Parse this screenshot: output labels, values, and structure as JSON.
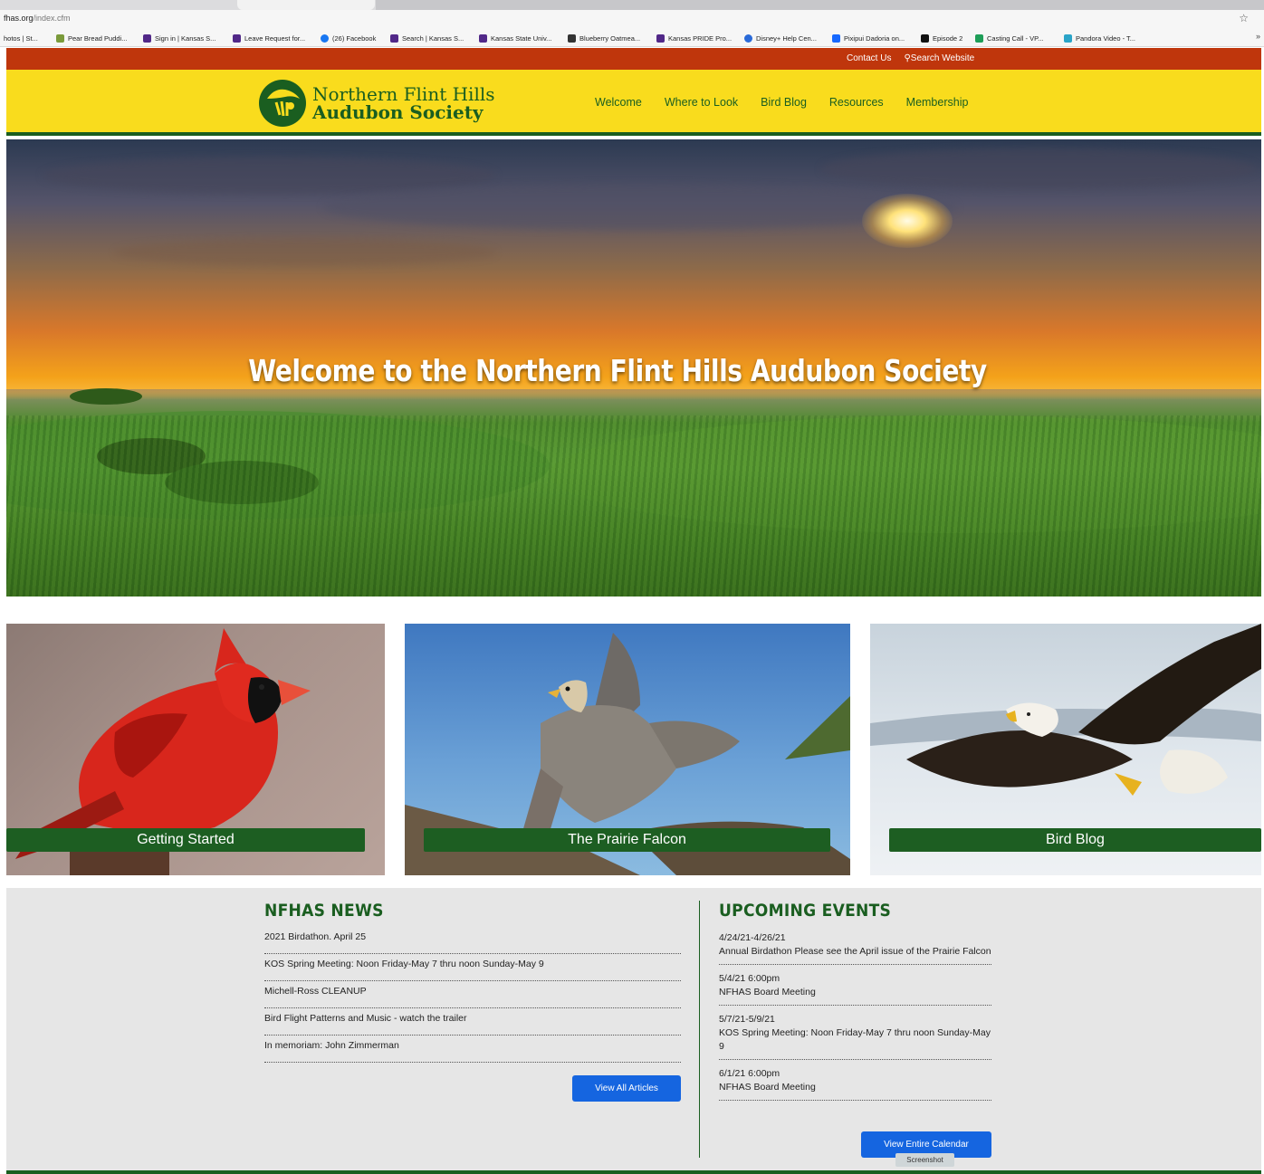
{
  "browser": {
    "url_host": "fhas.org",
    "url_path": "/index.cfm",
    "bookmarks": [
      {
        "label": "hotos | St...",
        "icon": "none"
      },
      {
        "label": "Pear Bread Puddi...",
        "icon": "pear-icon",
        "color": "#7a9a3a"
      },
      {
        "label": "Sign in | Kansas S...",
        "icon": "powercat-icon",
        "color": "#512888"
      },
      {
        "label": "Leave Request for...",
        "icon": "powercat-icon",
        "color": "#512888"
      },
      {
        "label": "(26) Facebook",
        "icon": "facebook-icon",
        "color": "#1877f2"
      },
      {
        "label": "Search | Kansas S...",
        "icon": "powercat-icon",
        "color": "#512888"
      },
      {
        "label": "Kansas State Univ...",
        "icon": "powercat-icon",
        "color": "#512888"
      },
      {
        "label": "Blueberry Oatmea...",
        "icon": "food-icon",
        "color": "#333333"
      },
      {
        "label": "Kansas PRIDE Pro...",
        "icon": "powercat-icon",
        "color": "#512888"
      },
      {
        "label": "Disney+ Help Cen...",
        "icon": "disney-icon",
        "color": "#2a6ad8"
      },
      {
        "label": "Pixipui Dadoria on...",
        "icon": "behance-icon",
        "color": "#1769ff"
      },
      {
        "label": "Episode 2",
        "icon": "a-icon",
        "color": "#111111"
      },
      {
        "label": "Casting Call - VP...",
        "icon": "sheets-icon",
        "color": "#1e9e58"
      },
      {
        "label": "Pandora Video - T...",
        "icon": "video-icon",
        "color": "#2aa4c8"
      }
    ],
    "bookmarks_more": "»"
  },
  "utility": {
    "contact": "Contact Us",
    "search": "Search Website"
  },
  "logo": {
    "line1": "Northern Flint Hills",
    "line2": "Audubon Society"
  },
  "nav": [
    "Welcome",
    "Where to Look",
    "Bird Blog",
    "Resources",
    "Membership"
  ],
  "hero": {
    "title": "Welcome to the Northern Flint Hills Audubon Society"
  },
  "cards": [
    {
      "label": "Getting Started",
      "image": "cardinal"
    },
    {
      "label": "The Prairie Falcon",
      "image": "falcon"
    },
    {
      "label": "Bird Blog",
      "image": "eagle"
    }
  ],
  "news": {
    "title": "NFHAS NEWS",
    "items": [
      "2021 Birdathon. April 25",
      "KOS Spring Meeting: Noon Friday-May 7 thru noon Sunday-May 9",
      "Michell-Ross CLEANUP",
      "Bird Flight Patterns and Music - watch the trailer",
      "In memoriam: John Zimmerman"
    ],
    "button": "View All Articles"
  },
  "events": {
    "title": "UPCOMING EVENTS",
    "items": [
      {
        "date": "4/24/21-4/26/21",
        "desc": "Annual Birdathon Please see the April issue of the Prairie Falcon"
      },
      {
        "date": "5/4/21 6:00pm",
        "desc": "NFHAS Board Meeting"
      },
      {
        "date": "5/7/21-5/9/21",
        "desc": "KOS Spring Meeting: Noon Friday-May 7 thru noon Sunday-May 9"
      },
      {
        "date": "6/1/21 6:00pm",
        "desc": "NFHAS Board Meeting"
      }
    ],
    "button": "View Entire Calendar"
  },
  "tooltip": "Screenshot",
  "colors": {
    "brand_green": "#1a5e20",
    "header_yellow": "#f9dc1d",
    "utility_red": "#bf360c",
    "button_blue": "#1565e0"
  }
}
